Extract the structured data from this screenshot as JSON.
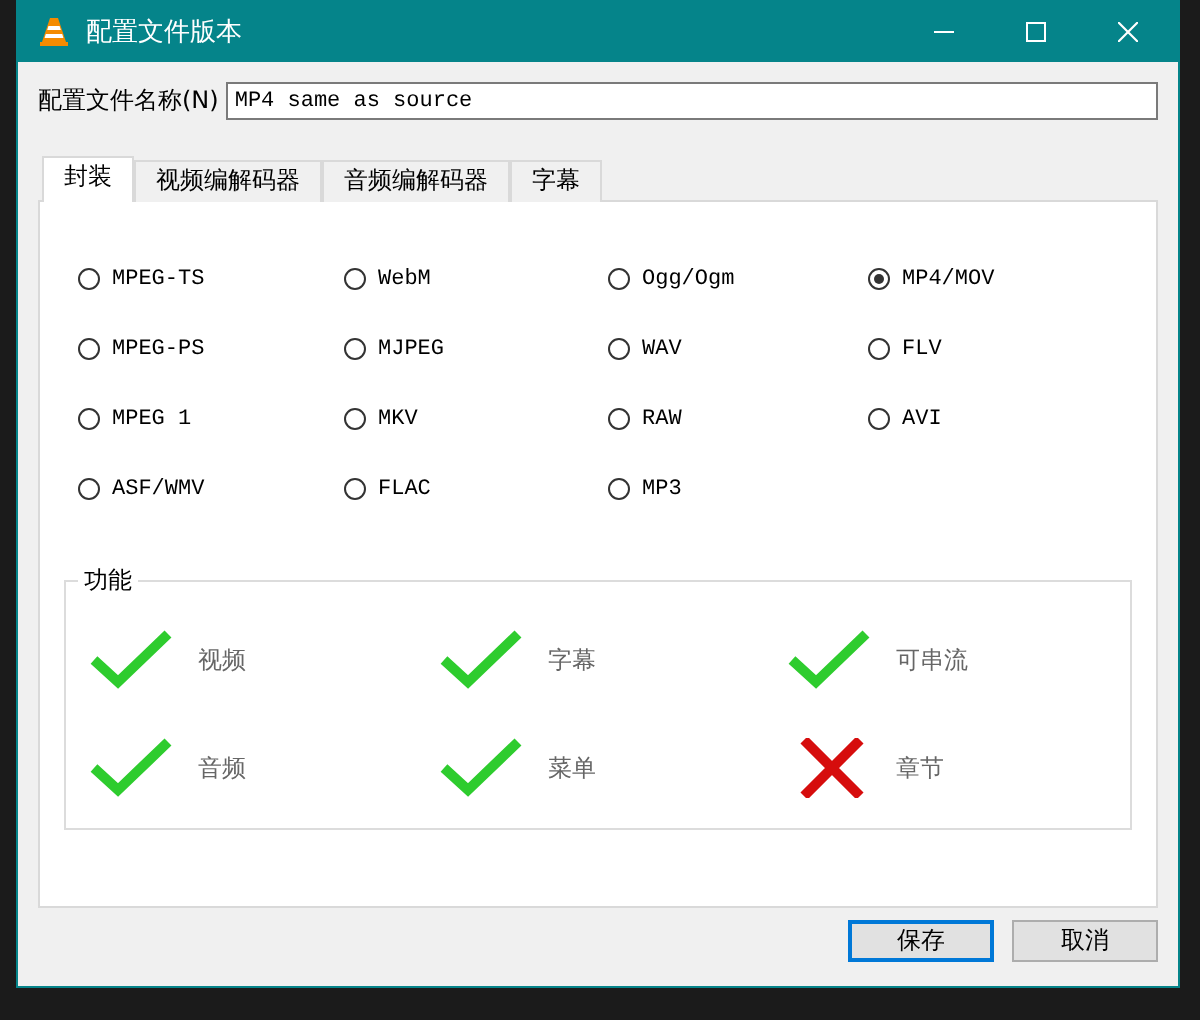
{
  "window": {
    "title": "配置文件版本"
  },
  "profile_name": {
    "label": "配置文件名称(N)",
    "value": "MP4 same as source"
  },
  "tabs": [
    {
      "label": "封装",
      "selected": true
    },
    {
      "label": "视频编解码器",
      "selected": false
    },
    {
      "label": "音频编解码器",
      "selected": false
    },
    {
      "label": "字幕",
      "selected": false
    }
  ],
  "containers": [
    {
      "label": "MPEG-TS",
      "selected": false
    },
    {
      "label": "WebM",
      "selected": false
    },
    {
      "label": "Ogg/Ogm",
      "selected": false
    },
    {
      "label": "MP4/MOV",
      "selected": true
    },
    {
      "label": "MPEG-PS",
      "selected": false
    },
    {
      "label": "MJPEG",
      "selected": false
    },
    {
      "label": "WAV",
      "selected": false
    },
    {
      "label": "FLV",
      "selected": false
    },
    {
      "label": "MPEG 1",
      "selected": false
    },
    {
      "label": "MKV",
      "selected": false
    },
    {
      "label": "RAW",
      "selected": false
    },
    {
      "label": "AVI",
      "selected": false
    },
    {
      "label": "ASF/WMV",
      "selected": false
    },
    {
      "label": "FLAC",
      "selected": false
    },
    {
      "label": "MP3",
      "selected": false
    }
  ],
  "features": {
    "title": "功能",
    "items": [
      {
        "label": "视频",
        "supported": true
      },
      {
        "label": "字幕",
        "supported": true
      },
      {
        "label": "可串流",
        "supported": true
      },
      {
        "label": "音频",
        "supported": true
      },
      {
        "label": "菜单",
        "supported": true
      },
      {
        "label": "章节",
        "supported": false
      }
    ]
  },
  "buttons": [
    "保存",
    "取消"
  ]
}
